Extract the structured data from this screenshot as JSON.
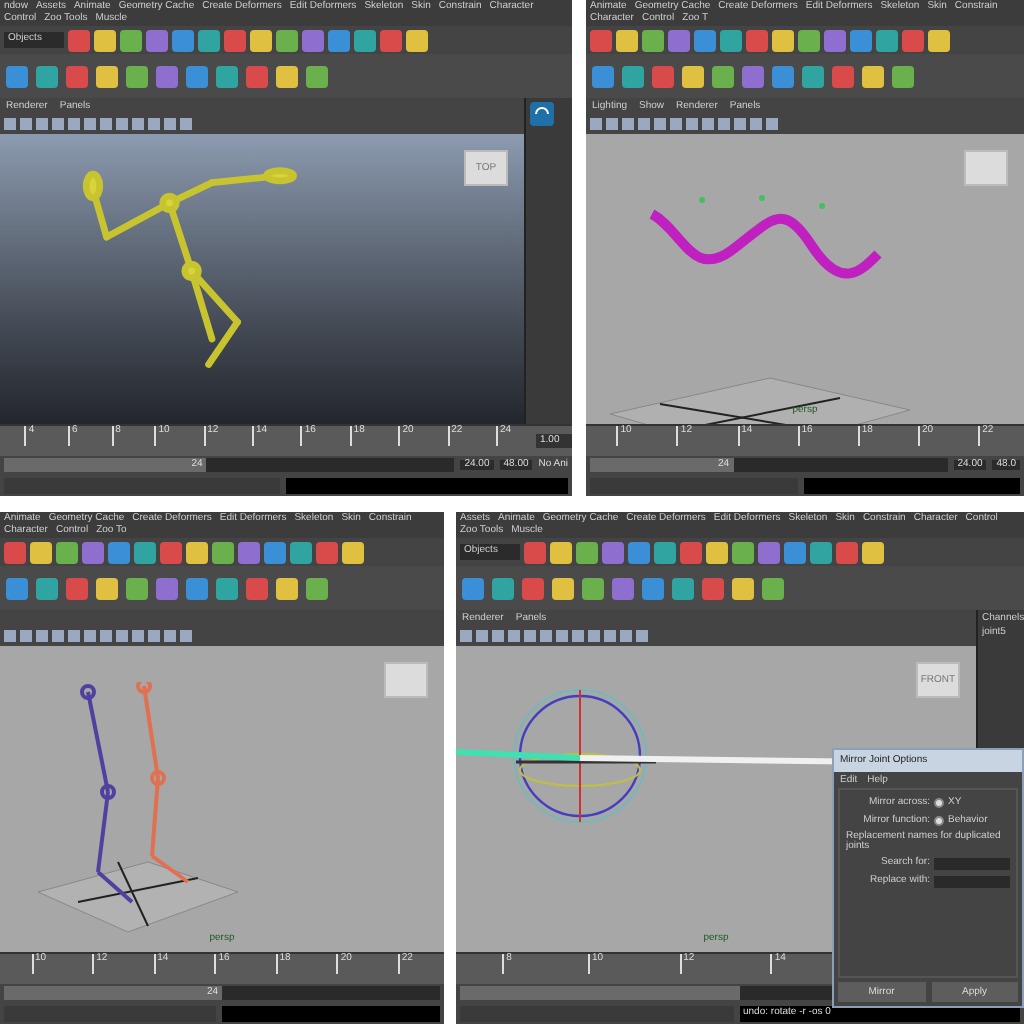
{
  "panels": [
    {
      "kind": "skeleton",
      "menus": [
        "ndow",
        "Assets",
        "Animate",
        "Geometry Cache",
        "Create Deformers",
        "Edit Deformers",
        "Skeleton",
        "Skin",
        "Constrain",
        "Character",
        "Control",
        "Zoo Tools",
        "Muscle"
      ],
      "selection_field": "Objects",
      "panel_menus": [
        "Renderer",
        "Panels"
      ],
      "viewcube": "TOP",
      "ticks": [
        "4",
        "6",
        "8",
        "10",
        "12",
        "14",
        "16",
        "18",
        "20",
        "22",
        "24"
      ],
      "current_time": "1.00",
      "range_slider": {
        "label": "24",
        "level": 0.45
      },
      "end_time": "24.00",
      "max_time": "48.00",
      "anim_layer": "No Ani"
    },
    {
      "kind": "curve",
      "menus": [
        "Animate",
        "Geometry Cache",
        "Create Deformers",
        "Edit Deformers",
        "Skeleton",
        "Skin",
        "Constrain",
        "Character",
        "Control",
        "Zoo T"
      ],
      "panel_menus": [
        "Lighting",
        "Show",
        "Renderer",
        "Panels"
      ],
      "camera": "persp",
      "ticks": [
        "10",
        "12",
        "14",
        "16",
        "18",
        "20",
        "22"
      ],
      "range_slider": {
        "label": "24",
        "level": 0.4
      },
      "end_time": "24.00",
      "max_time": "48.0"
    },
    {
      "kind": "legs",
      "menus": [
        "Animate",
        "Geometry Cache",
        "Create Deformers",
        "Edit Deformers",
        "Skeleton",
        "Skin",
        "Constrain",
        "Character",
        "Control",
        "Zoo To"
      ],
      "camera": "persp",
      "ticks": [
        "10",
        "12",
        "14",
        "16",
        "18",
        "20",
        "22"
      ],
      "range_slider": {
        "label": "24",
        "level": 0.5
      }
    },
    {
      "kind": "mirror",
      "menus": [
        "Assets",
        "Animate",
        "Geometry Cache",
        "Create Deformers",
        "Edit Deformers",
        "Skeleton",
        "Skin",
        "Constrain",
        "Character",
        "Control",
        "Zoo Tools",
        "Muscle"
      ],
      "selection_field": "Objects",
      "panel_menus": [
        "Renderer",
        "Panels"
      ],
      "viewcube": "FRONT",
      "camera": "persp",
      "ticks": [
        "8",
        "10",
        "12",
        "14"
      ],
      "range_slider": {
        "level": 0.5
      },
      "channels_title": "Channels",
      "channels_item": "joint5",
      "command_result": "undo: rotate -r -os 0",
      "dialog": {
        "title": "Mirror Joint Options",
        "menus": [
          "Edit",
          "Help"
        ],
        "options": [
          {
            "label": "Mirror across:",
            "value": "XY",
            "selected": true
          },
          {
            "label": "Mirror function:",
            "value": "Behavior",
            "selected": true
          }
        ],
        "note": "Replacement names for duplicated joints",
        "fields": [
          "Search for:",
          "Replace with:"
        ],
        "buttons": [
          "Mirror",
          "Apply"
        ]
      }
    }
  ]
}
